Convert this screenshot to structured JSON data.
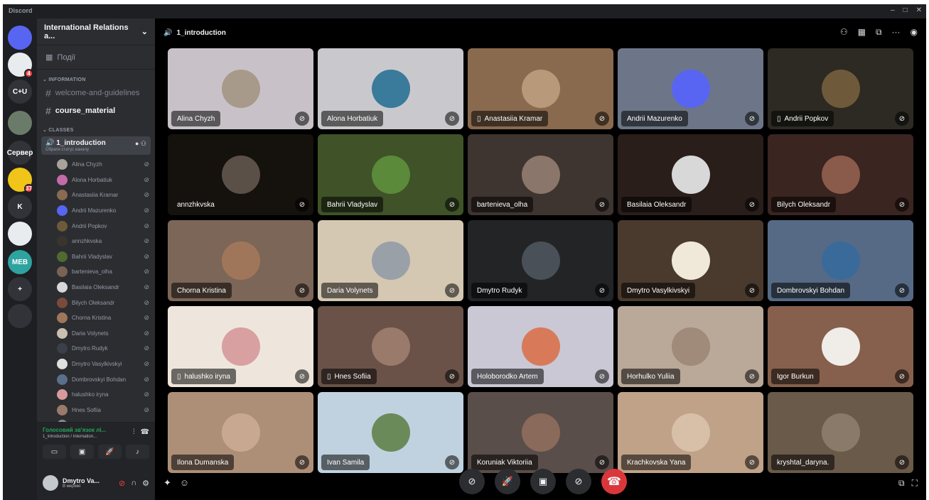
{
  "window": {
    "title": "Discord",
    "controls": [
      "–",
      "□",
      "✕"
    ]
  },
  "rail": {
    "servers": [
      {
        "label": "",
        "color": "#5865f2",
        "icon": "discord-home-icon"
      },
      {
        "label": "",
        "color": "#e8ecef",
        "badge": "4",
        "icon": "sailboat-logo"
      },
      {
        "label": "C+U",
        "color": "#313338",
        "icon": ""
      },
      {
        "label": "",
        "color": "#6b7b6a",
        "icon": "server-photo"
      },
      {
        "label": "Сервер",
        "color": "#313338",
        "icon": ""
      },
      {
        "label": "",
        "color": "#f0c419",
        "badge": "37",
        "icon": "server-logo"
      },
      {
        "label": "K",
        "color": "#313338",
        "icon": ""
      },
      {
        "label": "",
        "color": "#e8ecef",
        "icon": "sailboat-logo"
      },
      {
        "label": "МЕВ",
        "color": "#2ea3a0",
        "icon": ""
      },
      {
        "label": "+",
        "color": "#313338",
        "icon": "add-server-icon"
      },
      {
        "label": "",
        "color": "#313338",
        "icon": "explore-icon"
      }
    ]
  },
  "sidebar": {
    "server_name": "International Relations a...",
    "events_label": "Події",
    "categories": {
      "information": "INFORMATION",
      "classes": "CLASSES"
    },
    "channels": {
      "welcome": "welcome-and-guidelines",
      "course": "course_material"
    },
    "voice_channel": {
      "name": "1_introduction",
      "status": "Обрати статус каналу"
    },
    "members": [
      {
        "name": "Alina Chyzh",
        "color": "#a8a29a"
      },
      {
        "name": "Alona Horbatiuk",
        "color": "#c46ba8"
      },
      {
        "name": "Anastasiia Kramar",
        "color": "#8a6a50"
      },
      {
        "name": "Andrii Mazurenko",
        "color": "#5865f2"
      },
      {
        "name": "Andrii Popkov",
        "color": "#6e5a3a"
      },
      {
        "name": "annzhkvska",
        "color": "#3a342e"
      },
      {
        "name": "Bahrii Vladyslav",
        "color": "#4f6b2e"
      },
      {
        "name": "bartenieva_olha",
        "color": "#7a6254"
      },
      {
        "name": "Basilaia Oleksandr",
        "color": "#d8d8d8"
      },
      {
        "name": "Bilych Oleksandr",
        "color": "#7a4a3a"
      },
      {
        "name": "Chorna Kristina",
        "color": "#a0765a"
      },
      {
        "name": "Daria Volynets",
        "color": "#c8c0b0"
      },
      {
        "name": "Dmytro Rudyk",
        "color": "#3a4048"
      },
      {
        "name": "Dmytro Vasylkivskyi",
        "color": "#e0e0e0"
      },
      {
        "name": "Dombrovskyi Bohdan",
        "color": "#5a6f8a"
      },
      {
        "name": "halushko iryna",
        "color": "#d89a9a"
      },
      {
        "name": "Hnes Sofiia",
        "color": "#9a7a6a"
      },
      {
        "name": "Holoborodko Artem",
        "color": "#8a8a9a"
      }
    ],
    "voice_status": {
      "connected": "Голосовий зв'язок лі...",
      "location": "1_introduction / Internation..."
    },
    "user": {
      "name": "Dmytro Va...",
      "status": "В мережі"
    }
  },
  "stage": {
    "channel_title": "1_introduction",
    "tiles": [
      {
        "name": "Alina Chyzh",
        "bg": "#c8c2c8",
        "av": "#a89a8a",
        "phone": false
      },
      {
        "name": "Alona Horbatiuk",
        "bg": "#c9c9cd",
        "av": "#3a7a9a",
        "phone": false
      },
      {
        "name": "Anastasiia Kramar",
        "bg": "#8a6a4e",
        "av": "#b89a7a",
        "phone": true
      },
      {
        "name": "Andrii Mazurenko",
        "bg": "#6d7688",
        "av": "#5865f2",
        "phone": false
      },
      {
        "name": "Andrii Popkov",
        "bg": "#2c2a22",
        "av": "#6e5a3a",
        "phone": true
      },
      {
        "name": "annzhkvska",
        "bg": "#15110d",
        "av": "#5a5048",
        "phone": false,
        "plain": true
      },
      {
        "name": "Bahrii Vladyslav",
        "bg": "#3f5228",
        "av": "#5a8a3a",
        "phone": false
      },
      {
        "name": "bartenieva_olha",
        "bg": "#3e3430",
        "av": "#8a766a",
        "phone": false
      },
      {
        "name": "Basilaia Oleksandr",
        "bg": "#2a1e1a",
        "av": "#d8d8d8",
        "phone": false
      },
      {
        "name": "Bilych Oleksandr",
        "bg": "#3a2520",
        "av": "#8a5a4a",
        "phone": false
      },
      {
        "name": "Chorna Kristina",
        "bg": "#7c6658",
        "av": "#a0765a",
        "phone": false
      },
      {
        "name": "Daria Volynets",
        "bg": "#d4c8b2",
        "av": "#9aa0a8",
        "phone": false
      },
      {
        "name": "Dmytro Rudyk",
        "bg": "#222426",
        "av": "#4a5058",
        "phone": false
      },
      {
        "name": "Dmytro Vasylkivskyi",
        "bg": "#4a3a2e",
        "av": "#f0e8d8",
        "phone": false
      },
      {
        "name": "Dombrovskyi Bohdan",
        "bg": "#566a86",
        "av": "#3a6a9a",
        "phone": false
      },
      {
        "name": "halushko iryna",
        "bg": "#eee6dc",
        "av": "#d8a0a0",
        "phone": true
      },
      {
        "name": "Hnes Sofiia",
        "bg": "#6a5248",
        "av": "#9a7a6a",
        "phone": true
      },
      {
        "name": "Holoborodko Artem",
        "bg": "#cac8d4",
        "av": "#d87a5a",
        "phone": false
      },
      {
        "name": "Horhulko Yuliia",
        "bg": "#baa898",
        "av": "#a08a7a",
        "phone": false
      },
      {
        "name": "Igor Burkun",
        "bg": "#86604c",
        "av": "#f0ece8",
        "phone": false
      },
      {
        "name": "Ilona Dumanska",
        "bg": "#ad8f78",
        "av": "#c8a890",
        "phone": false
      },
      {
        "name": "Ivan Samila",
        "bg": "#c0d2e0",
        "av": "#6a8a5a",
        "phone": false
      },
      {
        "name": "Koruniak Viktoriia",
        "bg": "#5a4e4a",
        "av": "#8a6a5a",
        "phone": false
      },
      {
        "name": "Krachkovska Yana",
        "bg": "#c0a288",
        "av": "#d8c0a8",
        "phone": false
      },
      {
        "name": "kryshtal_daryna.",
        "bg": "#6a5a4a",
        "av": "#8a7a6a",
        "phone": false
      }
    ]
  }
}
